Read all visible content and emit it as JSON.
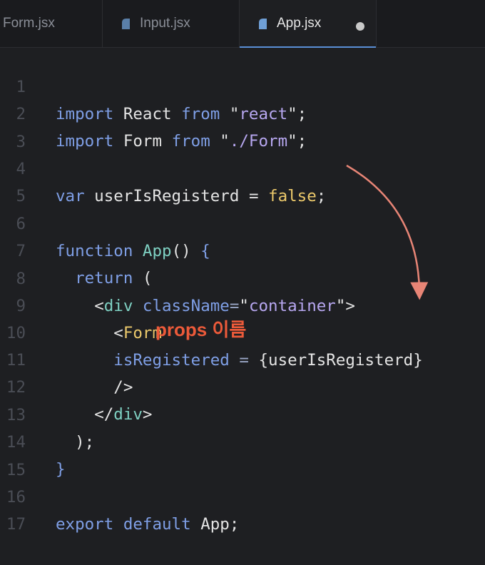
{
  "tabs": [
    {
      "label": "Form.jsx",
      "active": false
    },
    {
      "label": "Input.jsx",
      "active": false
    },
    {
      "label": "App.jsx",
      "active": true,
      "unsaved": true
    }
  ],
  "lines": [
    {
      "n": "1"
    },
    {
      "n": "2"
    },
    {
      "n": "3"
    },
    {
      "n": "4"
    },
    {
      "n": "5"
    },
    {
      "n": "6"
    },
    {
      "n": "7"
    },
    {
      "n": "8"
    },
    {
      "n": "9"
    },
    {
      "n": "10"
    },
    {
      "n": "11"
    },
    {
      "n": "12"
    },
    {
      "n": "13"
    },
    {
      "n": "14"
    },
    {
      "n": "15"
    },
    {
      "n": "16"
    },
    {
      "n": "17"
    }
  ],
  "code": {
    "l1": {
      "import": "import",
      "name": " React ",
      "from": "from",
      "sp": " ",
      "q1": "\"",
      "mod": "react",
      "q2": "\"",
      "semi": ";"
    },
    "l2": {
      "import": "import",
      "name": " Form ",
      "from": "from",
      "sp": " ",
      "q1": "\"",
      "mod": "./Form",
      "q2": "\"",
      "semi": ";"
    },
    "l4": {
      "var": "var",
      "name": " userIsRegisterd ",
      "eq": "=",
      "sp": " ",
      "val": "false",
      "semi": ";"
    },
    "l6": {
      "function": "function",
      "sp": " ",
      "name": "App",
      "paren": "()",
      "sp2": " ",
      "brace": "{"
    },
    "l7": {
      "indent": "  ",
      "ret": "return",
      "rest": " ("
    },
    "l8": {
      "indent": "    ",
      "lt": "<",
      "tag": "div",
      "sp": " ",
      "attr": "className",
      "eq": "=",
      "q1": "\"",
      "val": "container",
      "q2": "\"",
      "gt": ">"
    },
    "l9": {
      "indent": "      ",
      "lt": "<",
      "comp": "Form"
    },
    "l10": {
      "indent": "      ",
      "attr": "isRegistered",
      "sp": " ",
      "eq": "=",
      "sp2": " ",
      "val": "{userIsRegisterd}"
    },
    "l11": {
      "indent": "      ",
      "close": "/>"
    },
    "l12": {
      "indent": "    ",
      "lt": "</",
      "tag": "div",
      "gt": ">"
    },
    "l13": {
      "indent": "  ",
      "rest": ");"
    },
    "l14": {
      "brace": "}"
    },
    "l16": {
      "export": "export",
      "sp": " ",
      "default": "default",
      "rest": " App;"
    }
  },
  "annotation": {
    "text": "props 이름",
    "color": "#ec5a3a"
  },
  "colors": {
    "background": "#1e1f22",
    "keyword": "#7f9fe6",
    "string": "#b7a7f0",
    "boolean": "#ecc96b",
    "function": "#7fd1c3",
    "arrow": "#e88576"
  }
}
